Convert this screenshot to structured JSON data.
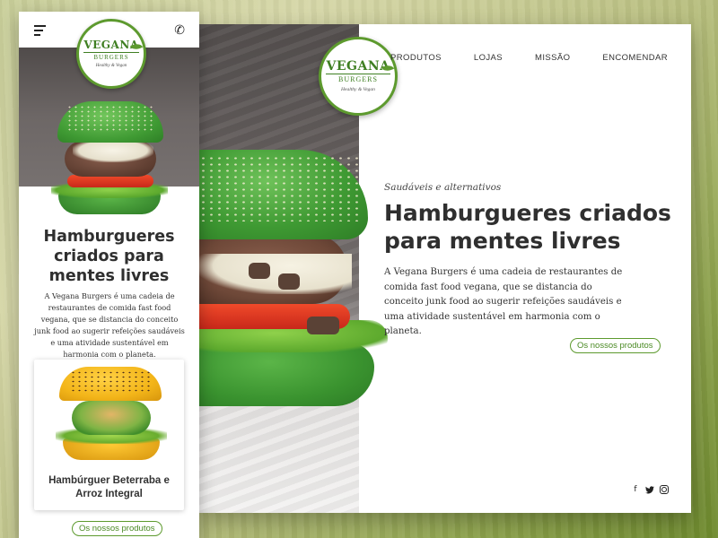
{
  "brand": {
    "name": "VEGANA",
    "sub": "BURGERS",
    "tagline": "Healthy & Vegan",
    "primary_color": "#5d9a2e"
  },
  "desktop": {
    "nav": [
      {
        "label": "PRODUTOS"
      },
      {
        "label": "LOJAS"
      },
      {
        "label": "MISSÃO"
      },
      {
        "label": "ENCOMENDAR"
      }
    ],
    "hero": {
      "tagline": "Saudáveis e alternativos",
      "title": "Hamburgueres criados para mentes livres",
      "description": "A Vegana Burgers é uma cadeia de restaurantes de comida fast food vegana, que se distancia do conceito junk food ao sugerir refeições saudáveis e uma atividade sustentável em harmonia com o planeta.",
      "button_label": "Os nossos produtos"
    },
    "social": [
      {
        "icon": "facebook-icon",
        "glyph": "f"
      },
      {
        "icon": "twitter-icon",
        "glyph": "🐦"
      },
      {
        "icon": "instagram-icon",
        "glyph": ""
      }
    ]
  },
  "mobile": {
    "menu_icon": "hamburger-menu-icon",
    "phone_icon": "phone-icon",
    "phone_glyph": "✆",
    "title": "Hamburgueres criados para mentes livres",
    "description": "A Vegana Burgers é uma cadeia de restaurantes de comida fast food vegana, que se distancia do conceito junk food ao sugerir refeições saudáveis e uma atividade sustentável em harmonia com o planeta.",
    "product_card": {
      "title": "Hambúrguer Beterraba e Arroz Integral"
    },
    "button_label": "Os nossos produtos"
  }
}
